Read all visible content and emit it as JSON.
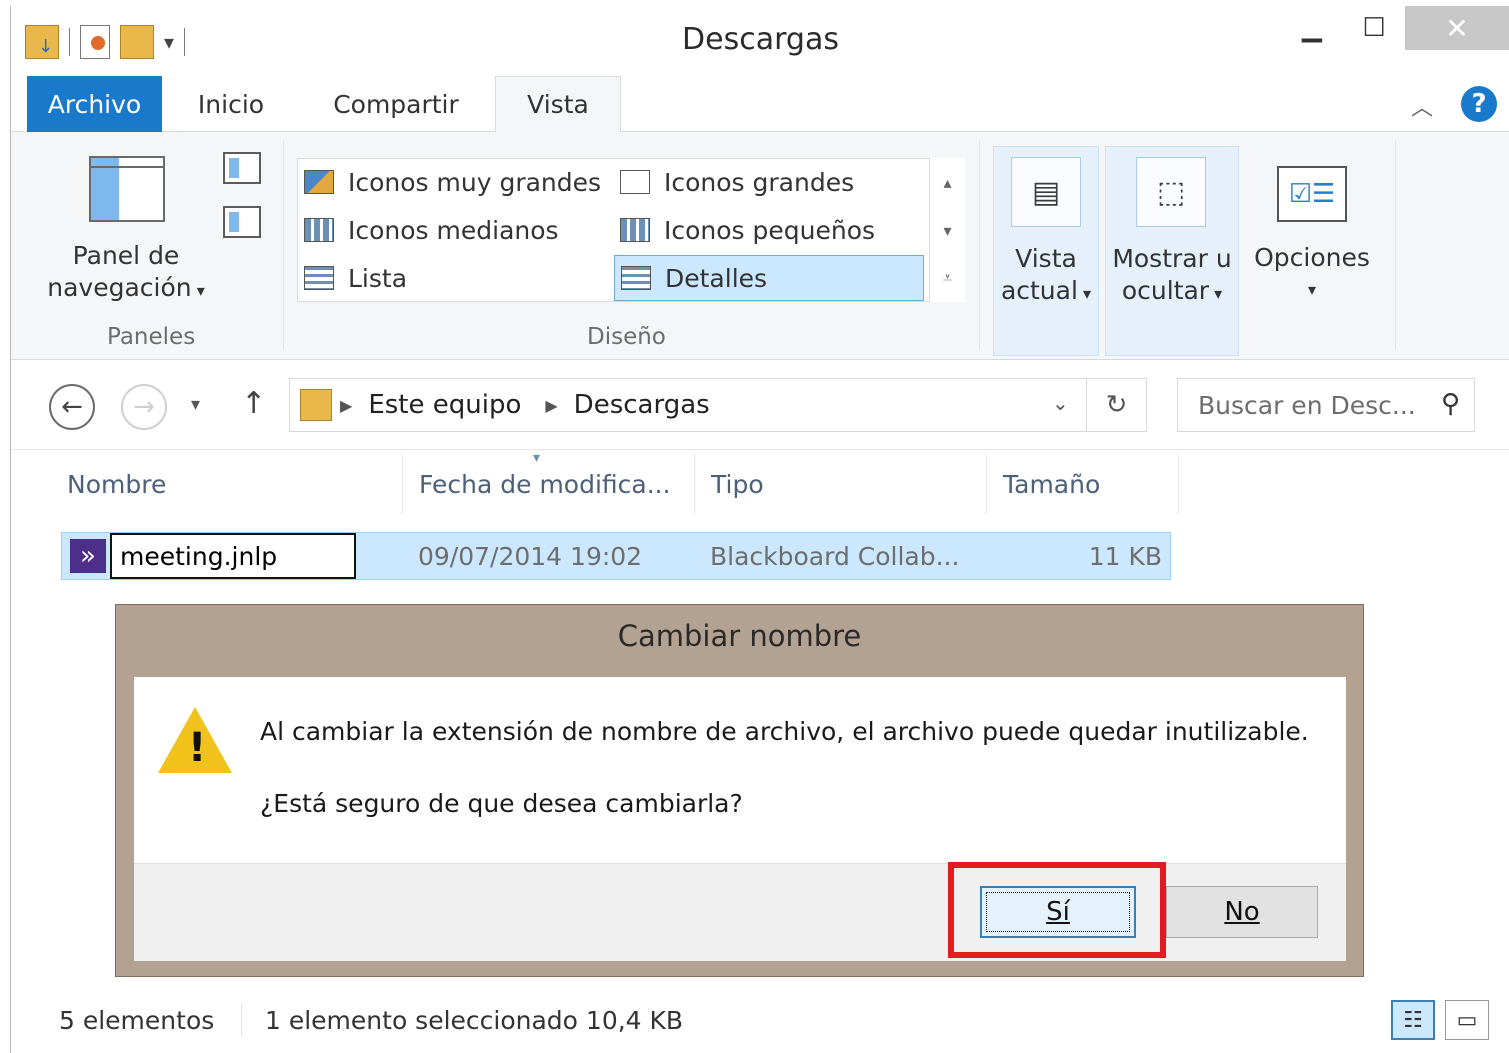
{
  "window": {
    "title": "Descargas"
  },
  "ribbon_tabs": [
    "Archivo",
    "Inicio",
    "Compartir",
    "Vista"
  ],
  "ribbon": {
    "panes": {
      "nav_pane_label_1": "Panel de",
      "nav_pane_label_2": "navegación",
      "group": "Paneles"
    },
    "layout": {
      "items": [
        "Iconos muy grandes",
        "Iconos grandes",
        "Iconos medianos",
        "Iconos pequeños",
        "Lista",
        "Detalles"
      ],
      "selected": "Detalles",
      "group": "Diseño"
    },
    "current_view": {
      "label_1": "Vista",
      "label_2": "actual"
    },
    "show_hide": {
      "label_1": "Mostrar u",
      "label_2": "ocultar"
    },
    "options": {
      "label": "Opciones"
    }
  },
  "address": {
    "path": [
      "Este equipo",
      "Descargas"
    ],
    "search_placeholder": "Buscar en Desc..."
  },
  "columns": [
    "Nombre",
    "Fecha de modifica...",
    "Tipo",
    "Tamaño"
  ],
  "files": [
    {
      "name": "meeting.jnlp",
      "date": "09/07/2014 19:02",
      "type": "Blackboard Collab...",
      "size": "11 KB"
    }
  ],
  "dialog": {
    "title": "Cambiar nombre",
    "message": "Al cambiar la extensión de nombre de archivo, el archivo puede quedar inutilizable.",
    "question": "¿Está seguro de que desea cambiarla?",
    "yes": "Sí",
    "no": "No"
  },
  "status": {
    "count": "5 elementos",
    "selection": "1 elemento seleccionado  10,4 KB"
  },
  "colors": {
    "accent": "#1979ca",
    "selection": "#cce8ff",
    "highlight": "#e21b22",
    "dialog_frame": "#b3a292"
  }
}
